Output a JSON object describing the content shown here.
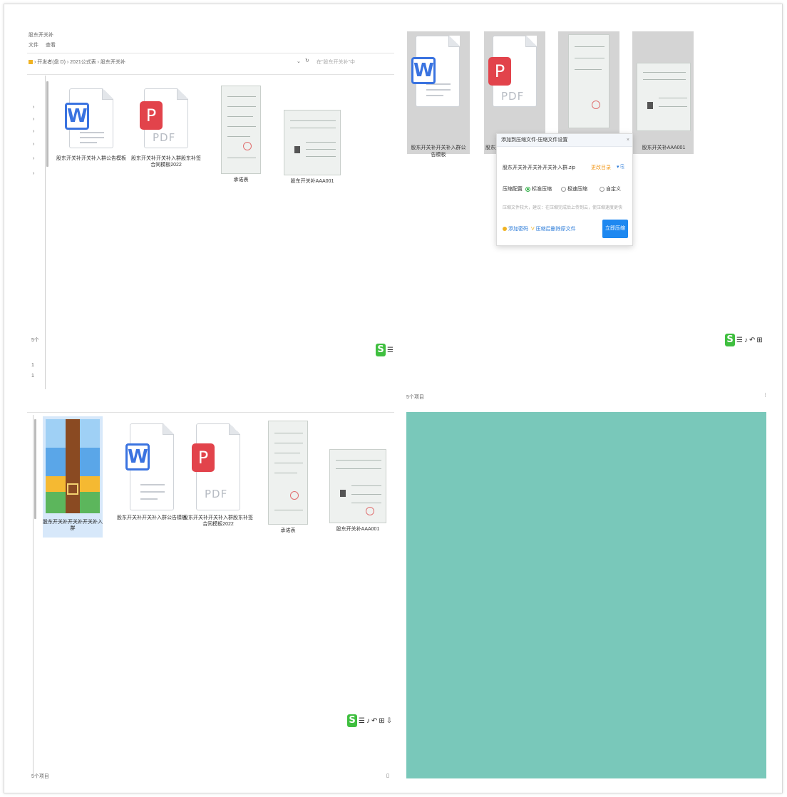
{
  "top_left": {
    "window_title": "股东开关补",
    "menu": [
      "文件",
      "查看"
    ],
    "breadcrumb": "› 开发者(盘 D) › 2021公式表 › 股东开关补",
    "refresh_icon": "refresh-icon",
    "search_placeholder": "在\"股东开关补\"中",
    "files": [
      {
        "label": "股东开关补开关补入群公告模板",
        "type": "word"
      },
      {
        "label": "股东开关补开关补入群股东补签合同模板2022",
        "type": "pdf"
      },
      {
        "label": "承诺表",
        "type": "scan"
      },
      {
        "label": "股东开关补AAA001",
        "type": "scan-wide"
      }
    ],
    "status_count": "5个"
  },
  "top_right": {
    "files": [
      {
        "label": "股东开关补开关补入群公告模板",
        "type": "word"
      },
      {
        "label": "股东开关补",
        "type": "pdf"
      },
      {
        "label": "",
        "type": "scan"
      },
      {
        "label": "股东开关补AAA001",
        "type": "scan-wide"
      }
    ],
    "popup": {
      "title": "添加到压缩文件-压缩文件设置",
      "close": "×",
      "filename": "股东开关补开关补开关补入群.zip",
      "filename_hint": "更改目录",
      "format_label": "压缩配置",
      "options": [
        "标准压缩",
        "极速压缩",
        "自定义"
      ],
      "tip": "压缩文件较大，建议：在压缩完成后上传到云，使压缩速度更快",
      "link_1": "添加密码",
      "link_2": "压缩后删除原文件",
      "confirm": "立即压缩"
    }
  },
  "bottom_left": {
    "files": [
      {
        "label": "股东开关补开关补开关补入群",
        "type": "archive",
        "selected": true
      },
      {
        "label": "股东开关补开关补入群公告模板",
        "type": "word"
      },
      {
        "label": "股东开关补开关补入群股东补签合同模板2022",
        "type": "pdf"
      },
      {
        "label": "承诺表",
        "type": "scan"
      },
      {
        "label": "股东开关补AAA001",
        "type": "scan-wide"
      }
    ],
    "status_count": "5个项目"
  },
  "bottom_right": {
    "title": "5个项目",
    "fill_color": "#79c8ba"
  },
  "colors": {
    "word_blue": "#3a73e0",
    "pdf_red": "#e2434b",
    "button_blue": "#1e88f0",
    "logo_green": "#3fbf3f",
    "selection": "#d7e8fa"
  }
}
